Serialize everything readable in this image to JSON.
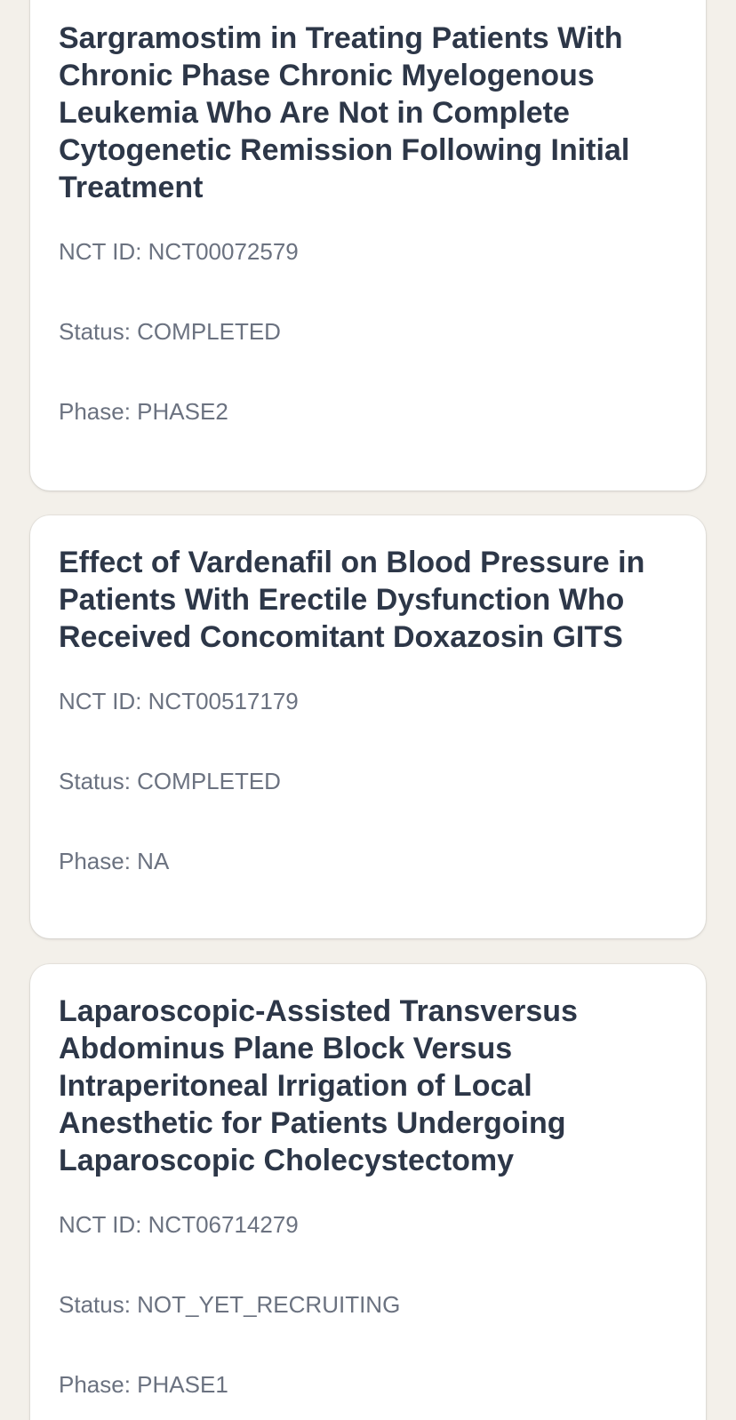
{
  "trials": [
    {
      "title": "Sargramostim in Treating Patients With Chronic Phase Chronic Myelogenous Leukemia Who Are Not in Complete Cytogenetic Remission Following Initial Treatment",
      "nct_id": "NCT ID: NCT00072579",
      "status": "Status: COMPLETED",
      "phase": "Phase: PHASE2"
    },
    {
      "title": "Effect of Vardenafil on Blood Pressure in Patients With Erectile Dysfunction Who Received Concomitant Doxazosin GITS",
      "nct_id": "NCT ID: NCT00517179",
      "status": "Status: COMPLETED",
      "phase": "Phase: NA"
    },
    {
      "title": "Laparoscopic-Assisted Transversus Abdominus Plane Block Versus Intraperitoneal Irrigation of Local Anesthetic for Patients Undergoing Laparoscopic Cholecystectomy",
      "nct_id": "NCT ID: NCT06714279",
      "status": "Status: NOT_YET_RECRUITING",
      "phase": "Phase: PHASE1"
    }
  ]
}
